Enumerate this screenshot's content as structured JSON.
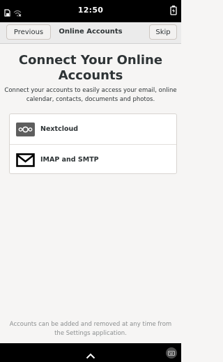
{
  "status_bar": {
    "time": "12:50",
    "icons": [
      "sim-locked-icon",
      "wifi-off-icon",
      "battery-charging-icon"
    ]
  },
  "header": {
    "previous_label": "Previous",
    "title": "Online Accounts",
    "skip_label": "Skip"
  },
  "main": {
    "heading": "Connect Your Online Accounts",
    "description": "Connect your accounts to easily access your email, online calendar, contacts, documents and photos.",
    "providers": [
      {
        "label": "Nextcloud",
        "icon": "nextcloud-icon"
      },
      {
        "label": "IMAP and SMTP",
        "icon": "mail-envelope-icon"
      }
    ],
    "footer": "Accounts can be added and removed at any time from the Settings application."
  },
  "nav_bar": {
    "icons": [
      "chevron-up-icon",
      "keyboard-icon"
    ]
  },
  "colors": {
    "background": "#f6f5f4",
    "bars": "#000000",
    "text": "#2e3436",
    "muted_text": "#8b8e8f"
  }
}
